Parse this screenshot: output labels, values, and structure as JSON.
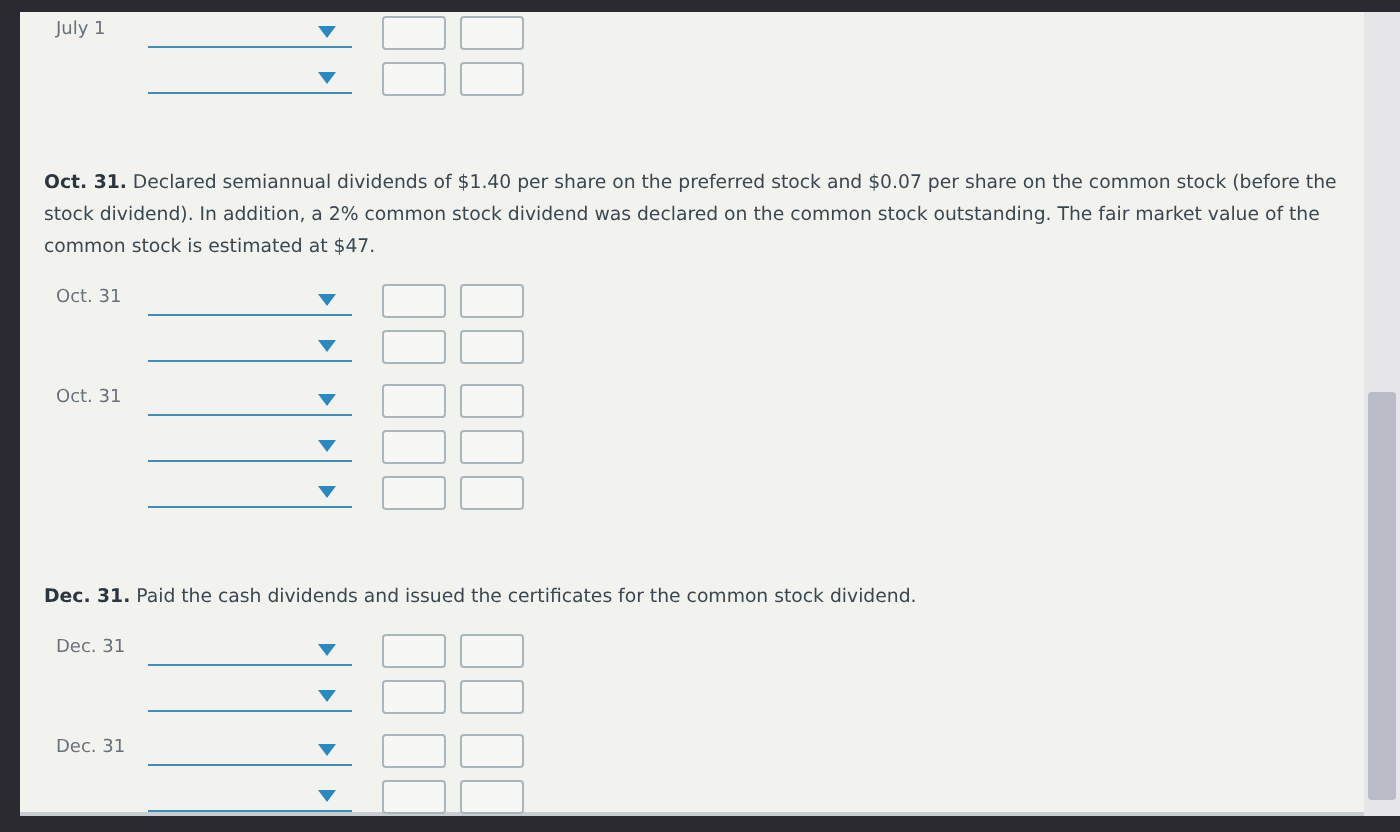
{
  "sections": [
    {
      "kind": "entries",
      "groups": [
        {
          "date": "July 1",
          "rows": [
            {
              "kind": "entry"
            },
            {
              "kind": "entry"
            }
          ]
        }
      ]
    },
    {
      "kind": "prompt",
      "text": "**Oct. 31.** Declared semiannual dividends of $1.40 per share on the preferred stock and $0.07 per share on the common stock (before the stock dividend). In addition, a 2% common stock dividend was declared on the common stock outstanding. The fair market value of the common stock is estimated at $47."
    },
    {
      "kind": "entries",
      "groups": [
        {
          "date": "Oct. 31",
          "rows": [
            {
              "kind": "entry"
            },
            {
              "kind": "entry"
            }
          ]
        },
        {
          "date": "Oct. 31",
          "rows": [
            {
              "kind": "entry"
            },
            {
              "kind": "entry"
            },
            {
              "kind": "entry"
            }
          ]
        }
      ]
    },
    {
      "kind": "prompt",
      "text": "**Dec. 31.** Paid the cash dividends and issued the certificates for the common stock dividend."
    },
    {
      "kind": "entries",
      "groups": [
        {
          "date": "Dec. 31",
          "rows": [
            {
              "kind": "entry"
            },
            {
              "kind": "entry"
            }
          ]
        },
        {
          "date": "Dec. 31",
          "rows": [
            {
              "kind": "entry"
            },
            {
              "kind": "entry"
            }
          ]
        }
      ]
    }
  ]
}
